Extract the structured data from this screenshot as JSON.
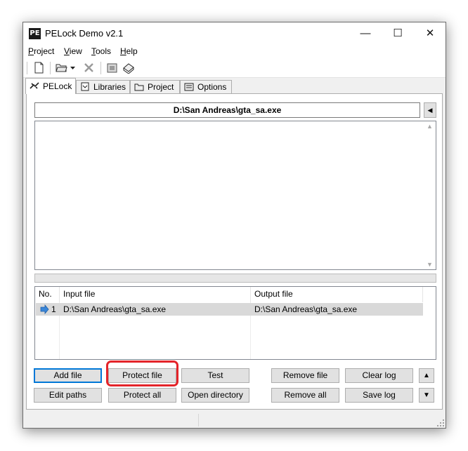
{
  "window": {
    "logo_text": "PE",
    "title": "PELock Demo v2.1",
    "controls": {
      "minimize": "—",
      "maximize": "☐",
      "close": "✕"
    }
  },
  "menu": {
    "project": {
      "hot": "P",
      "rest": "roject"
    },
    "view": {
      "hot": "V",
      "rest": "iew"
    },
    "tools": {
      "hot": "T",
      "rest": "ools"
    },
    "help": {
      "hot": "H",
      "rest": "elp"
    }
  },
  "toolbar_icons": [
    "new-file-icon",
    "open-folder-icon",
    "dropdown-arrow-icon",
    "close-x-icon",
    "protect-icon",
    "book-icon"
  ],
  "tabs": [
    {
      "label": "PELock",
      "icon": "pelock-icon",
      "active": true
    },
    {
      "label": "Libraries",
      "icon": "libraries-icon",
      "active": false
    },
    {
      "label": "Project",
      "icon": "project-icon",
      "active": false
    },
    {
      "label": "Options",
      "icon": "options-icon",
      "active": false
    }
  ],
  "main": {
    "path": "D:\\San Andreas\\gta_sa.exe",
    "progress_percent": 0
  },
  "table": {
    "headers": {
      "no": "No.",
      "input": "Input file",
      "output": "Output file"
    },
    "rows": [
      {
        "no": "1",
        "input": "D:\\San Andreas\\gta_sa.exe",
        "output": "D:\\San Andreas\\gta_sa.exe"
      }
    ]
  },
  "buttons": {
    "add_file": "Add file",
    "protect_file": "Protect file",
    "test": "Test",
    "remove_file": "Remove file",
    "clear_log": "Clear log",
    "edit_paths": "Edit paths",
    "protect_all": "Protect all",
    "open_directory": "Open directory",
    "remove_all": "Remove all",
    "save_log": "Save log",
    "move_up": "▲",
    "move_down": "▼"
  },
  "colors": {
    "highlight": "#e4242a",
    "accent": "#0078d7",
    "arrow": "#3a86d8"
  }
}
